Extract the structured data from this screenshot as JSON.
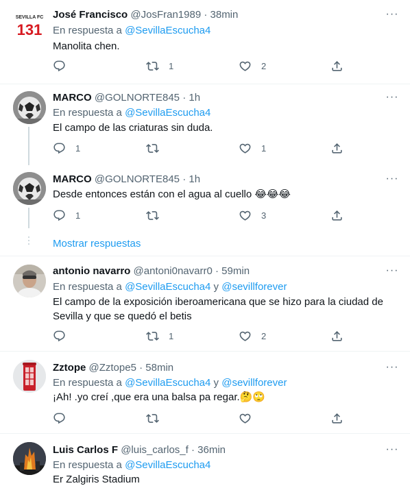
{
  "reply_prefix": "En respuesta a",
  "and_word": "y",
  "show_replies": "Mostrar respuestas",
  "more_glyph": "···",
  "tweets": [
    {
      "name": "José Francisco",
      "handle": "@JosFran1989",
      "time": "· 38min",
      "mention1": "@SevillaEscucha4",
      "text": "Manolita chen.",
      "replies": "",
      "retweets": "1",
      "likes": "2",
      "avatar": "sevilla-fc-logo",
      "avatar_text": "SEVILLA FC",
      "avatar_num": "131"
    },
    {
      "name": "MARCO",
      "handle": "@GOLNORTE845",
      "time": "· 1h",
      "mention1": "@SevillaEscucha4",
      "text": "El campo de las criaturas sin duda.",
      "replies": "1",
      "retweets": "",
      "likes": "1",
      "avatar": "football-ball-photo"
    },
    {
      "name": "MARCO",
      "handle": "@GOLNORTE845",
      "time": "· 1h",
      "text": "Desde entonces están con el agua al cuello",
      "emoji": "😂😂😂",
      "replies": "1",
      "retweets": "",
      "likes": "3",
      "avatar": "football-ball-photo"
    },
    {
      "name": "antonio navarro",
      "handle": "@antoni0navarr0",
      "time": "· 59min",
      "mention1": "@SevillaEscucha4",
      "mention2": "@sevillforever",
      "text": "El campo de la exposición iberoamericana que se hizo para la ciudad de Sevilla y que se quedó el betis",
      "replies": "",
      "retweets": "1",
      "likes": "2",
      "avatar": "man-portrait-photo"
    },
    {
      "name": "Zztope",
      "handle": "@Zztope5",
      "time": "· 58min",
      "mention1": "@SevillaEscucha4",
      "mention2": "@sevillforever",
      "text": "¡Ah! .yo creí ,que era una balsa pa regar.",
      "emoji": "🤔🙄",
      "replies": "",
      "retweets": "",
      "likes": "",
      "avatar": "red-phone-booth-photo"
    },
    {
      "name": "Luis Carlos F",
      "handle": "@luis_carlos_f",
      "time": "· 36min",
      "mention1": "@SevillaEscucha4",
      "text": "Er Zalgiris Stadium",
      "avatar": "burning-building-photo"
    }
  ]
}
